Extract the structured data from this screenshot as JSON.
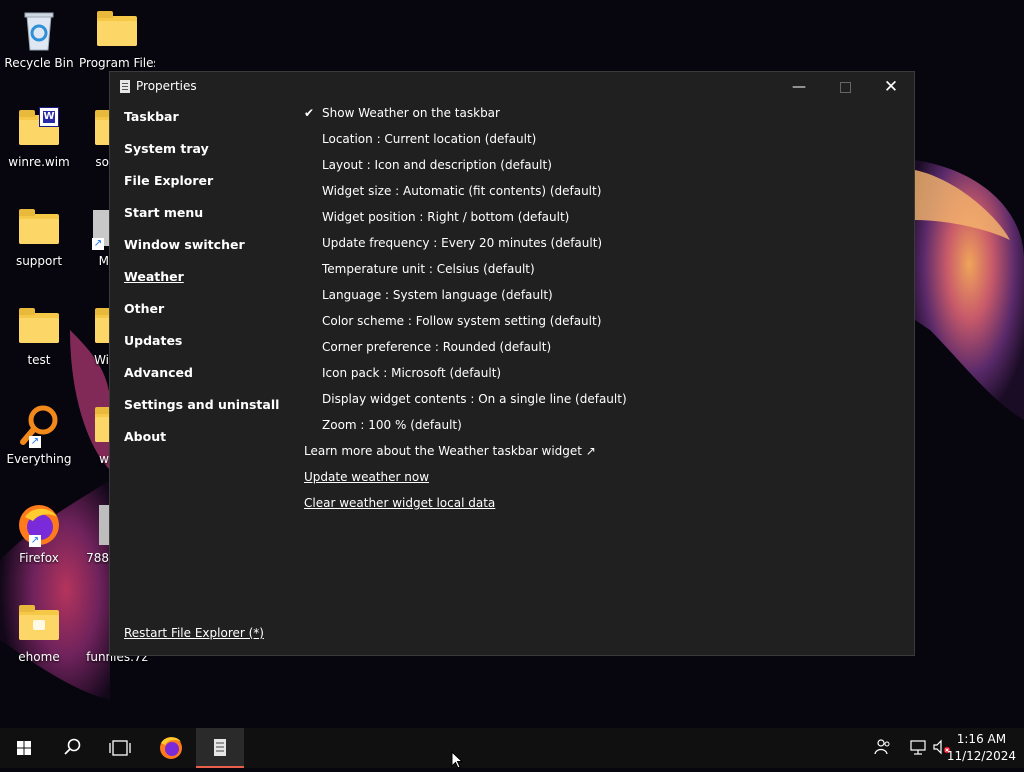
{
  "desktop": {
    "icons": [
      {
        "label": "Recycle Bin"
      },
      {
        "label": "Program Files"
      },
      {
        "label": "winre.wim"
      },
      {
        "label": "so"
      },
      {
        "label": "support"
      },
      {
        "label": "M"
      },
      {
        "label": "test"
      },
      {
        "label": "Wi"
      },
      {
        "label": "Everything"
      },
      {
        "label": "w"
      },
      {
        "label": "Firefox"
      },
      {
        "label": "788"
      },
      {
        "label": "ehome"
      },
      {
        "label": "funnies.7z"
      }
    ]
  },
  "window": {
    "title": "Properties",
    "nav": [
      {
        "label": "Taskbar"
      },
      {
        "label": "System tray"
      },
      {
        "label": "File Explorer"
      },
      {
        "label": "Start menu"
      },
      {
        "label": "Window switcher"
      },
      {
        "label": "Weather",
        "active": true
      },
      {
        "label": "Other"
      },
      {
        "label": "Updates"
      },
      {
        "label": "Advanced"
      },
      {
        "label": "Settings and uninstall"
      },
      {
        "label": "About"
      }
    ],
    "options": [
      {
        "label": "Show Weather on the taskbar",
        "checked": true,
        "check_glyph": "✔"
      },
      {
        "label": "Location : Current location (default)"
      },
      {
        "label": "Layout : Icon and description (default)"
      },
      {
        "label": "Widget size : Automatic (fit contents) (default)"
      },
      {
        "label": "Widget position : Right / bottom (default)"
      },
      {
        "label": "Update frequency : Every 20 minutes (default)"
      },
      {
        "label": "Temperature unit : Celsius (default)"
      },
      {
        "label": "Language : System language (default)"
      },
      {
        "label": "Color scheme : Follow system setting (default)"
      },
      {
        "label": "Corner preference : Rounded (default)"
      },
      {
        "label": "Icon pack : Microsoft (default)"
      },
      {
        "label": "Display widget contents : On a single line (default)"
      },
      {
        "label": "Zoom : 100 % (default)"
      }
    ],
    "links": [
      {
        "label": "Learn more about the Weather taskbar widget ↗"
      },
      {
        "label": "Update weather now"
      },
      {
        "label": "Clear weather widget local data"
      }
    ],
    "restart_label": "Restart File Explorer (*)",
    "buttons": {
      "minimize": "—",
      "close": "✕"
    }
  },
  "taskbar": {
    "clock": {
      "time": "1:16 AM",
      "date": "11/12/2024"
    },
    "search_glyph": "⚲"
  },
  "colors": {
    "window_bg": "#202020",
    "accent": "#e8604c",
    "folder": "#f5c947"
  }
}
